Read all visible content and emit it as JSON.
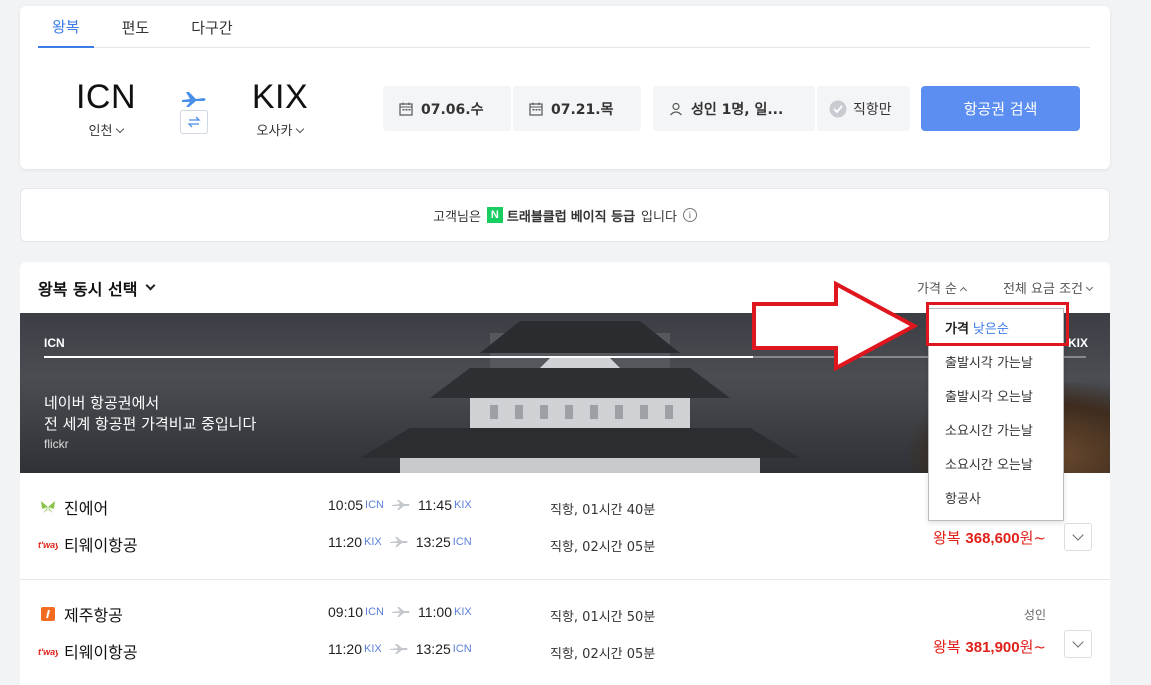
{
  "trip_tabs": [
    {
      "label": "왕복",
      "active": true
    },
    {
      "label": "편도",
      "active": false
    },
    {
      "label": "다구간",
      "active": false
    }
  ],
  "origin": {
    "code": "ICN",
    "city": "인천"
  },
  "destination": {
    "code": "KIX",
    "city": "오사카"
  },
  "dates": {
    "departure": "07.06.수",
    "return": "07.21.목"
  },
  "passengers": "성인 1명, 일...",
  "direct_only": "직항만",
  "search_button": "항공권 검색",
  "grade_banner": {
    "prefix": "고객님은",
    "badge": "N",
    "program": "트래블클럽",
    "grade": "베이직 등급",
    "suffix": "입니다",
    "info_icon": "info-icon"
  },
  "results": {
    "header": "왕복 동시 선택",
    "sort_label": "가격 순",
    "fare_filter": "전체 요금 조건",
    "hero": {
      "from": "ICN",
      "to": "KIX",
      "progress": 0.68,
      "message_line1": "네이버 항공권에서",
      "message_line2": "전 세계 항공편 가격비교 중입니다",
      "credit": "flickr"
    },
    "flights": [
      {
        "outbound": {
          "airline": "진에어",
          "logo": "jinair-logo",
          "dep_time": "10:05",
          "dep_ap": "ICN",
          "arr_time": "11:45",
          "arr_ap": "KIX",
          "duration": "직항, 01시간 40분"
        },
        "inbound": {
          "airline": "티웨이항공",
          "logo": "tway-logo",
          "dep_time": "11:20",
          "dep_ap": "KIX",
          "arr_time": "13:25",
          "arr_ap": "ICN",
          "duration": "직항, 02시간 05분"
        },
        "pax": "",
        "price_prefix": "왕복",
        "price_amount": "368,600",
        "price_unit": "원~"
      },
      {
        "outbound": {
          "airline": "제주항공",
          "logo": "jejuair-logo",
          "dep_time": "09:10",
          "dep_ap": "ICN",
          "arr_time": "11:00",
          "arr_ap": "KIX",
          "duration": "직항, 01시간 50분"
        },
        "inbound": {
          "airline": "티웨이항공",
          "logo": "tway-logo",
          "dep_time": "11:20",
          "dep_ap": "KIX",
          "arr_time": "13:25",
          "arr_ap": "ICN",
          "duration": "직항, 02시간 05분"
        },
        "pax": "성인",
        "price_prefix": "왕복",
        "price_amount": "381,900",
        "price_unit": "원~"
      }
    ]
  },
  "sort_menu": {
    "items": [
      {
        "label": "가격",
        "highlight": "낮은순",
        "selected": true
      },
      {
        "label": "출발시각 가는날"
      },
      {
        "label": "출발시각 오는날"
      },
      {
        "label": "소요시간 가는날"
      },
      {
        "label": "소요시간 오는날"
      },
      {
        "label": "항공사"
      }
    ]
  },
  "colors": {
    "accent": "#3b7ce8",
    "search_button": "#5b8ef0",
    "price": "#e0211a",
    "annotation": "#e0161e"
  }
}
